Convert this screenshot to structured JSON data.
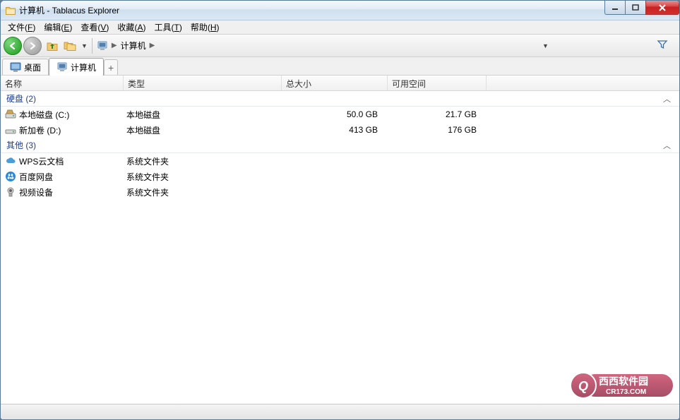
{
  "window": {
    "title": "计算机 - Tablacus Explorer"
  },
  "menu": {
    "file": {
      "label": "文件",
      "key": "F"
    },
    "edit": {
      "label": "编辑",
      "key": "E"
    },
    "view": {
      "label": "查看",
      "key": "V"
    },
    "favorites": {
      "label": "收藏",
      "key": "A"
    },
    "tools": {
      "label": "工具",
      "key": "T"
    },
    "help": {
      "label": "帮助",
      "key": "H"
    }
  },
  "breadcrumb": {
    "item": "计算机"
  },
  "tabs": {
    "items": [
      {
        "label": "桌面"
      },
      {
        "label": "计算机"
      }
    ],
    "add_label": "+"
  },
  "columns": {
    "name": "名称",
    "type": "类型",
    "total": "总大小",
    "free": "可用空间"
  },
  "groups": [
    {
      "label": "硬盘 (2)",
      "rows": [
        {
          "icon": "drive",
          "name": "本地磁盘 (C:)",
          "type": "本地磁盘",
          "total": "50.0 GB",
          "free": "21.7 GB"
        },
        {
          "icon": "drive-alt",
          "name": "新加卷 (D:)",
          "type": "本地磁盘",
          "total": "413 GB",
          "free": "176 GB"
        }
      ]
    },
    {
      "label": "其他 (3)",
      "rows": [
        {
          "icon": "cloud",
          "name": "WPS云文档",
          "type": "系统文件夹",
          "total": "",
          "free": ""
        },
        {
          "icon": "baidu",
          "name": "百度网盘",
          "type": "系统文件夹",
          "total": "",
          "free": ""
        },
        {
          "icon": "camera",
          "name": "视频设备",
          "type": "系统文件夹",
          "total": "",
          "free": ""
        }
      ]
    }
  ],
  "watermark": {
    "line1": "西西软件园",
    "line2": "CR173.COM"
  }
}
